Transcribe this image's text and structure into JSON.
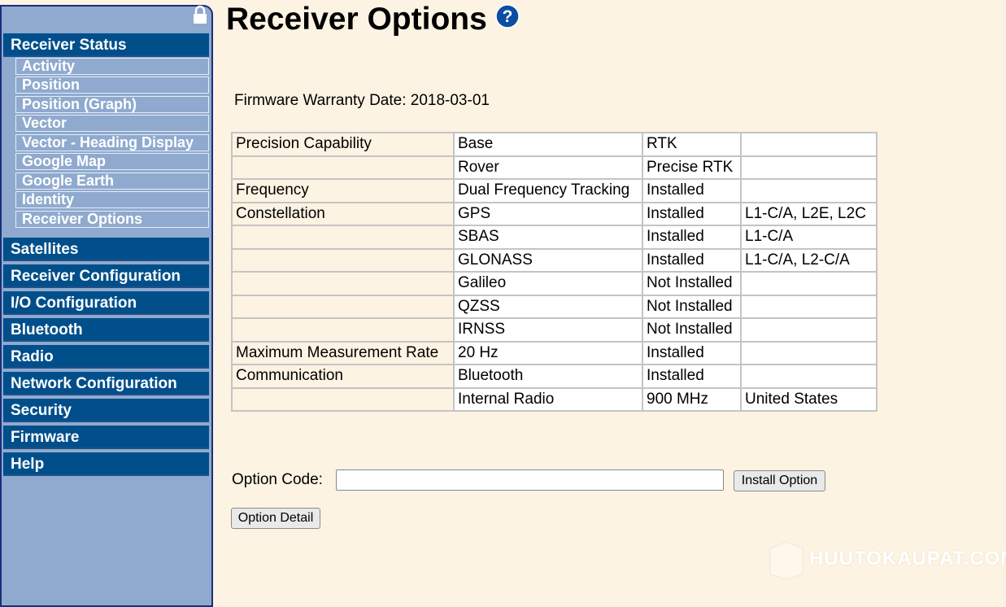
{
  "sidebar": {
    "groups": [
      {
        "label": "Receiver Status"
      },
      {
        "label": "Satellites"
      },
      {
        "label": "Receiver Configuration"
      },
      {
        "label": "I/O Configuration"
      },
      {
        "label": "Bluetooth"
      },
      {
        "label": "Radio"
      },
      {
        "label": "Network Configuration"
      },
      {
        "label": "Security"
      },
      {
        "label": "Firmware"
      },
      {
        "label": "Help"
      }
    ],
    "status_items": [
      {
        "label": "Activity"
      },
      {
        "label": "Position"
      },
      {
        "label": "Position (Graph)"
      },
      {
        "label": "Vector"
      },
      {
        "label": "Vector - Heading Display"
      },
      {
        "label": "Google Map"
      },
      {
        "label": "Google Earth"
      },
      {
        "label": "Identity"
      },
      {
        "label": "Receiver Options"
      }
    ]
  },
  "header": {
    "title": "Receiver Options"
  },
  "main": {
    "warranty": "Firmware Warranty Date: 2018-03-01",
    "rows": [
      [
        "Precision Capability",
        "Base",
        "RTK",
        ""
      ],
      [
        "",
        "Rover",
        "Precise RTK",
        ""
      ],
      [
        "Frequency",
        "Dual Frequency Tracking",
        "Installed",
        ""
      ],
      [
        "Constellation",
        "GPS",
        "Installed",
        "L1-C/A, L2E, L2C"
      ],
      [
        "",
        "SBAS",
        "Installed",
        "L1-C/A"
      ],
      [
        "",
        "GLONASS",
        "Installed",
        "L1-C/A, L2-C/A"
      ],
      [
        "",
        "Galileo",
        "Not Installed",
        ""
      ],
      [
        "",
        "QZSS",
        "Not Installed",
        ""
      ],
      [
        "",
        "IRNSS",
        "Not Installed",
        ""
      ],
      [
        "Maximum Measurement Rate",
        "20 Hz",
        "Installed",
        ""
      ],
      [
        "Communication",
        "Bluetooth",
        "Installed",
        ""
      ],
      [
        "",
        "Internal Radio",
        "900 MHz",
        "United States"
      ]
    ],
    "option_code_label": "Option Code:",
    "option_code_value": "",
    "install_label": "Install Option",
    "detail_label": "Option Detail"
  },
  "watermark": {
    "text": "HUUTOKAUPAT.COM"
  },
  "colors": {
    "nav_dark": "#004f8b",
    "sidebar_bg": "#8faace",
    "page_bg": "#fdf3e3",
    "help_icon": "#0b4ea2"
  },
  "icons": {
    "lock": "lock-icon",
    "help": "help-icon"
  }
}
